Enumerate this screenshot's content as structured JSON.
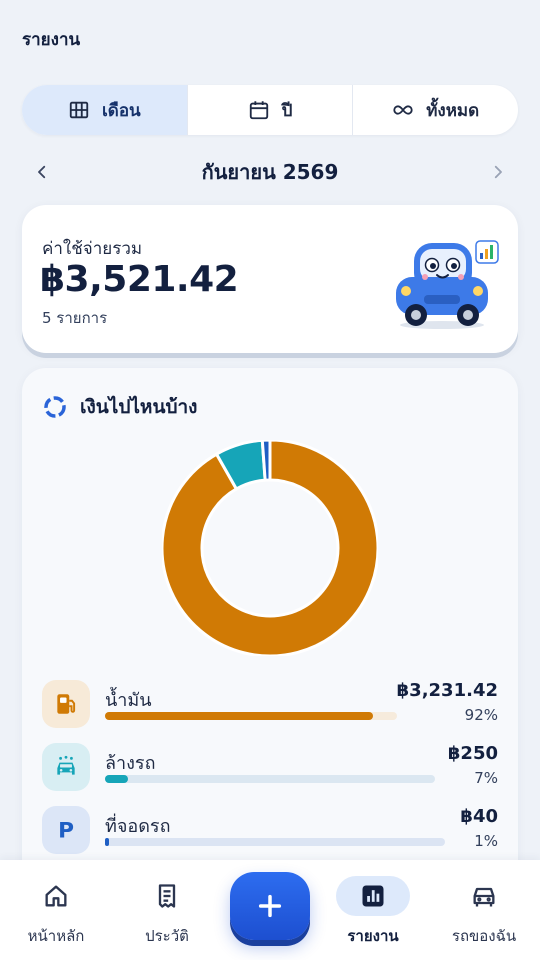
{
  "header": {
    "title": "รายงาน"
  },
  "period_tabs": [
    {
      "label": "เดือน",
      "icon": "grid-icon",
      "active": true
    },
    {
      "label": "ปี",
      "icon": "calendar-icon",
      "active": false
    },
    {
      "label": "ทั้งหมด",
      "icon": "infinity-icon",
      "active": false
    }
  ],
  "month_nav": {
    "label": "กันยายน 2569"
  },
  "summary": {
    "label": "ค่าใช้จ่ายรวม",
    "amount": "฿3,521.42",
    "count": "5 รายการ"
  },
  "breakdown": {
    "title": "เงินไปไหนบ้าง",
    "categories": [
      {
        "name": "น้ำมัน",
        "amount": "฿3,231.42",
        "percent": "92%",
        "share": 0.918,
        "color": "#d07a05",
        "track": "#f6ebdc",
        "icon_bg": "#f7ead8",
        "icon": "fuel-icon"
      },
      {
        "name": "ล้างรถ",
        "amount": "฿250",
        "percent": "7%",
        "share": 0.071,
        "color": "#16a5b8",
        "track": "#dbe7f1",
        "icon_bg": "#d8eef3",
        "icon": "car-wash-icon"
      },
      {
        "name": "ที่จอดรถ",
        "amount": "฿40",
        "percent": "1%",
        "share": 0.011,
        "color": "#1f5fc4",
        "track": "#dbe4f3",
        "icon_bg": "#dce6f7",
        "icon": "parking-icon"
      }
    ]
  },
  "chart_data": {
    "type": "pie",
    "categories": [
      "น้ำมัน",
      "ล้างรถ",
      "ที่จอดรถ"
    ],
    "values": [
      3231.42,
      250,
      40
    ],
    "colors": [
      "#d07a05",
      "#16a5b8",
      "#1f5fc4"
    ]
  },
  "bottom_nav": [
    {
      "label": "หน้าหลัก",
      "icon": "home-icon",
      "active": false
    },
    {
      "label": "ประวัติ",
      "icon": "receipt-icon",
      "active": false
    },
    {
      "label": "รายงาน",
      "icon": "bar-chart-icon",
      "active": true
    },
    {
      "label": "รถของฉัน",
      "icon": "car-icon",
      "active": false
    }
  ]
}
